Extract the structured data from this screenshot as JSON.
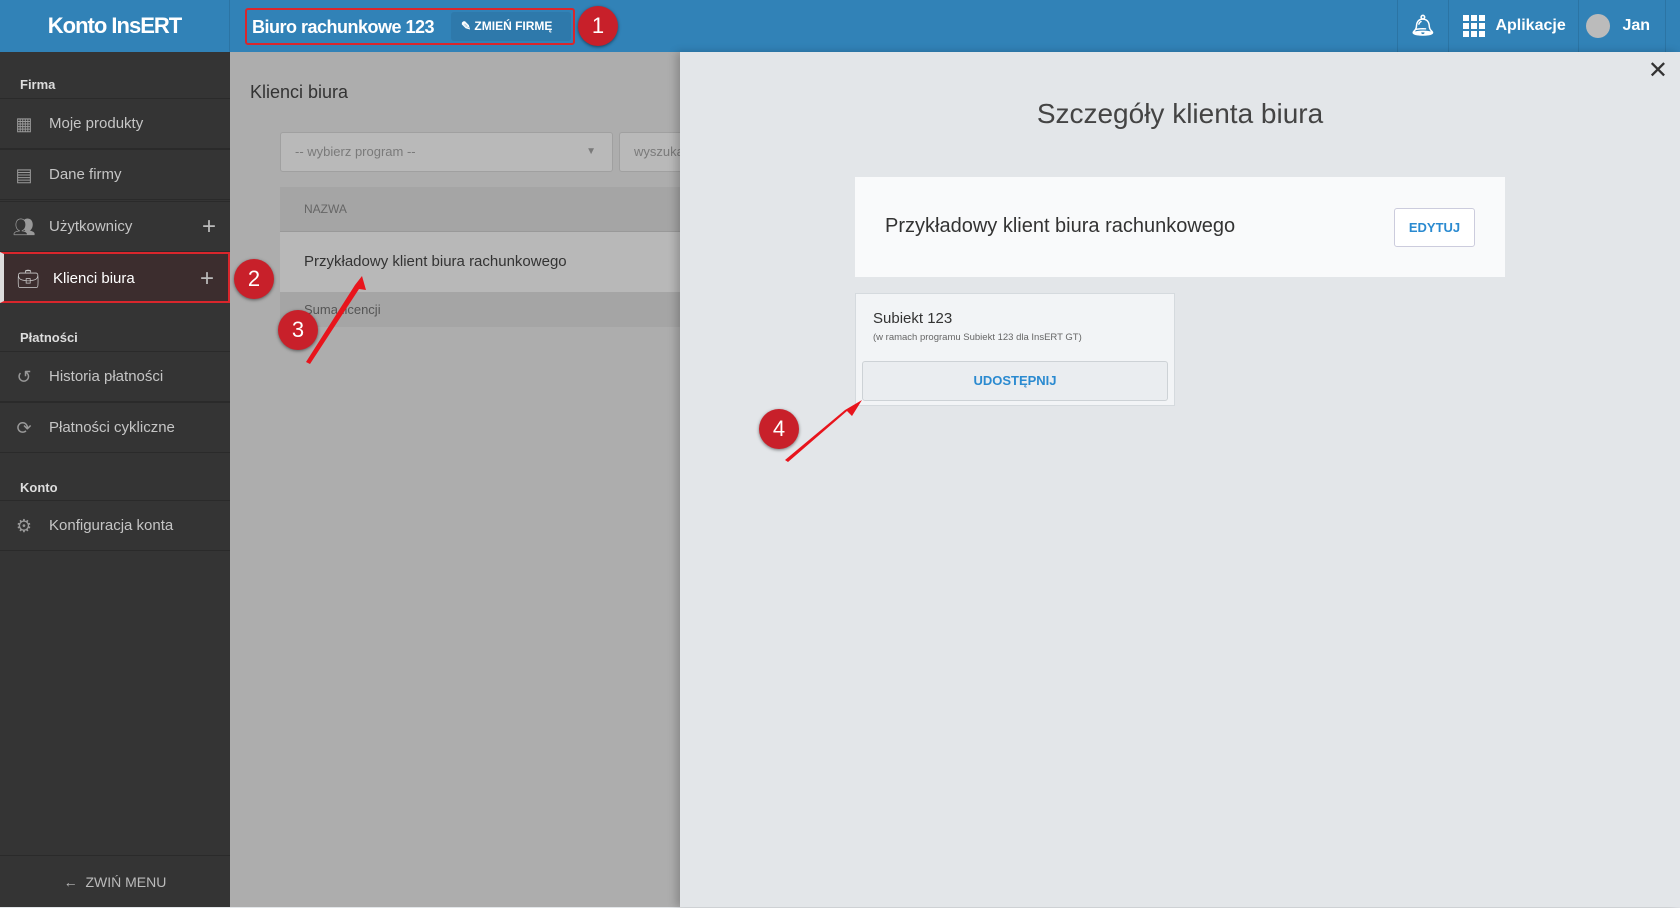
{
  "header": {
    "logo": "Konto InsERT",
    "company": "Biuro rachunkowe 123",
    "change_company": "ZMIEŃ FIRMĘ",
    "apps": "Aplikacje",
    "user": "Jan"
  },
  "sidebar": {
    "sections": {
      "firma": "Firma",
      "platnosci": "Płatności",
      "konto": "Konto"
    },
    "items": [
      {
        "label": "Moje produkty"
      },
      {
        "label": "Dane firmy"
      },
      {
        "label": "Użytkownicy"
      },
      {
        "label": "Klienci biura"
      },
      {
        "label": "Historia płatności"
      },
      {
        "label": "Płatności cykliczne"
      },
      {
        "label": "Konfiguracja konta"
      }
    ],
    "collapse": "ZWIŃ MENU"
  },
  "main": {
    "title": "Klienci biura",
    "program_placeholder": "-- wybierz program --",
    "search_placeholder": "wyszukaj",
    "column": "NAZWA",
    "row": "Przykładowy klient biura rachunkowego",
    "footer": "Suma licencji"
  },
  "panel": {
    "title": "Szczegóły klienta biura",
    "client_name": "Przykładowy klient biura rachunkowego",
    "edit": "EDYTUJ",
    "product": "Subiekt 123",
    "product_desc": "(w ramach programu Subiekt 123 dla InsERT GT)",
    "share": "UDOSTĘPNIJ"
  },
  "annotations": [
    "1",
    "2",
    "3",
    "4"
  ],
  "colors": {
    "header": "#3182b7",
    "sidebar": "#343434",
    "accent": "#2a8ad0",
    "annotation": "#d9262c"
  }
}
